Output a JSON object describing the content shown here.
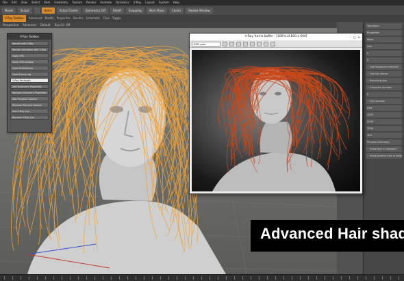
{
  "menubar": [
    "File",
    "Edit",
    "View",
    "Select",
    "Item",
    "Geometry",
    "Texture",
    "Render",
    "Animate",
    "Dynamics",
    "V-Ray",
    "Layout",
    "System",
    "Help"
  ],
  "toolbar": {
    "buttons": [
      "Model",
      "Sculpt",
      "",
      "Items",
      "Action Center",
      "Symmetry: Off",
      "Falloff",
      "Snapping",
      "Work Plane",
      "Center",
      "Render Window"
    ],
    "active_index": 3
  },
  "subbar": [
    "V-Ray Toolbox",
    "Advanced",
    "Modify",
    "Properties",
    "Render",
    "Schematic",
    "Clips",
    "Toggle"
  ],
  "viewport": {
    "header": [
      "Perspective",
      "Advanced",
      "Default",
      "Ray GL: Off"
    ],
    "readout": [
      "Info",
      "Polygons",
      "Channels",
      "Deformers",
      "GL: 603,268"
    ]
  },
  "toolbox": {
    "title": "V-Ray Toolbox",
    "items": [
      "Render with V-Ray",
      "Render animation with V-Ray",
      "Open VFB",
      "Show VFB window",
      "Open Preferences",
      "Open Event Log",
      "V-Ray Packages",
      "Add Geometry Properties",
      "Remove Geometry Properties",
      "Add Physical Camera",
      "Remove Physical Camera",
      "Add V-Ray Sun",
      "Remove V-Ray Sun"
    ],
    "highlight_index": 6
  },
  "framebuffer": {
    "title": "V-Ray frame buffer - [100% of 800 x 600]",
    "channel": "RGB color"
  },
  "right_panel": [
    "Transform",
    "Properties",
    "Mesh",
    "Hair",
    "0",
    "0",
    "Use Sequence override",
    "Use full names",
    "Bounding box",
    "Compute normals",
    "0",
    "Flip normals",
    "Unit",
    "1000",
    "2000",
    "1000",
    "100",
    "Preview Geometry",
    "Show hair in viewport",
    "Show particle size in viewport"
  ],
  "caption": "Advanced Hair shader",
  "colors": {
    "accent": "#d88a2a",
    "hair_viewport": "#f0a43c",
    "hair_render": "#c9491b"
  }
}
